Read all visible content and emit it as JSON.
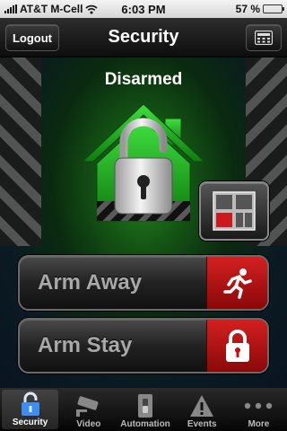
{
  "status_bar": {
    "carrier": "AT&T M-Cell",
    "time": "6:03 PM",
    "battery_percent": "57 %",
    "battery_level": 0.57
  },
  "nav": {
    "title": "Security",
    "logout_label": "Logout",
    "keypad_icon": "keypad-icon"
  },
  "main": {
    "system_status": "Disarmed",
    "house_icon": "house-unlocked-icon",
    "sensor_icon": "sensor-zones-icon",
    "accent_color": "#2bbf2b",
    "alert_color": "#d42020"
  },
  "actions": {
    "arm_away": {
      "label": "Arm Away",
      "icon": "running-person-icon"
    },
    "arm_stay": {
      "label": "Arm Stay",
      "icon": "lock-icon"
    }
  },
  "tabs": [
    {
      "label": "Security",
      "icon": "lock-icon",
      "active": true
    },
    {
      "label": "Video",
      "icon": "camera-icon",
      "active": false
    },
    {
      "label": "Automation",
      "icon": "switch-icon",
      "active": false
    },
    {
      "label": "Events",
      "icon": "warning-icon",
      "active": false
    },
    {
      "label": "More",
      "icon": "more-icon",
      "active": false
    }
  ]
}
